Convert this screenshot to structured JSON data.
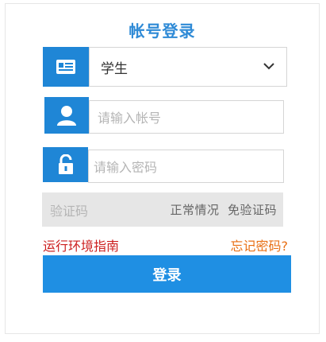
{
  "title": "帐号登录",
  "role_select": {
    "value": "学生",
    "icon": "id-card-icon"
  },
  "account": {
    "placeholder": "请输入帐号",
    "icon": "user-icon"
  },
  "password": {
    "placeholder": "请输入密码",
    "icon": "lock-icon"
  },
  "captcha": {
    "placeholder": "验证码",
    "note": "正常情况  免验证码"
  },
  "links": {
    "env_guide": "运行环境指南",
    "forgot_password": "忘记密码?"
  },
  "login_button": "登录",
  "colors": {
    "accent": "#1f86d6",
    "button": "#1f8fe3",
    "title": "#2e8ad6",
    "link_red": "#cc1f1f",
    "link_orange": "#e86f14"
  }
}
